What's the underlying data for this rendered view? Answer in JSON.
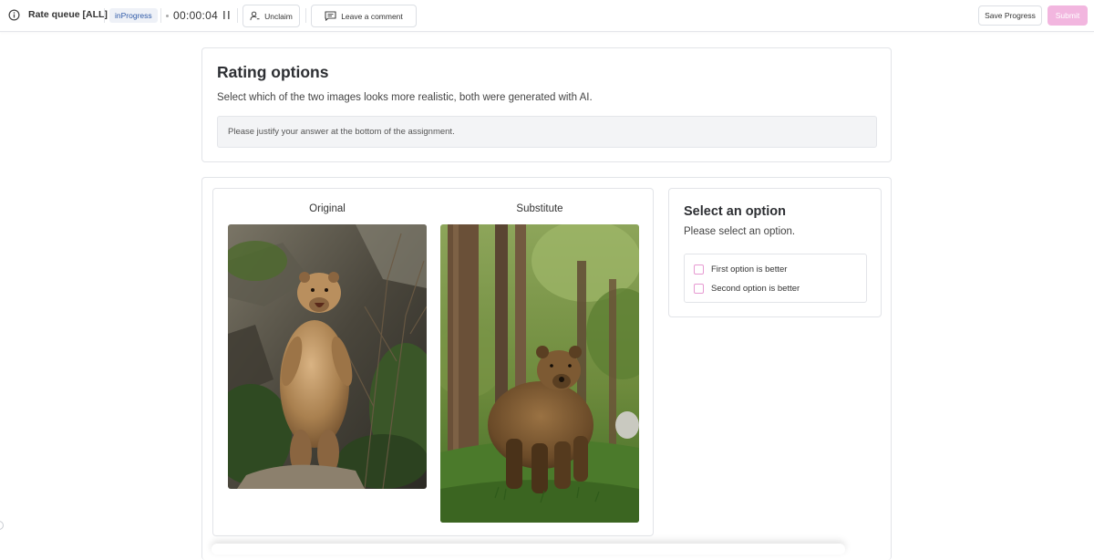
{
  "topbar": {
    "queue_title": "Rate queue [ALL]",
    "status": "inProgress",
    "timer": "00:00:04",
    "unclaim_label": "Unclaim",
    "comment_label": "Leave a comment",
    "save_label": "Save Progress",
    "submit_label": "Submit",
    "icons": [
      "info-icon",
      "pause-icon",
      "user-remove-icon",
      "comment-icon"
    ]
  },
  "rating": {
    "title": "Rating options",
    "description": "Select which of the two images looks more realistic, both were generated with AI.",
    "justify_note": "Please justify your answer at the bottom of the assignment."
  },
  "compare": {
    "original_label": "Original",
    "substitute_label": "Substitute"
  },
  "options": {
    "title": "Select an option",
    "subtitle": "Please select an option.",
    "items": [
      {
        "label": "First option is better",
        "checked": false
      },
      {
        "label": "Second option is better",
        "checked": false
      }
    ]
  },
  "colors": {
    "accent": "#f2b6df",
    "checkbox_border": "#e79ad2",
    "badge_text": "#2f5aa8",
    "badge_bg": "#eef1f7"
  }
}
